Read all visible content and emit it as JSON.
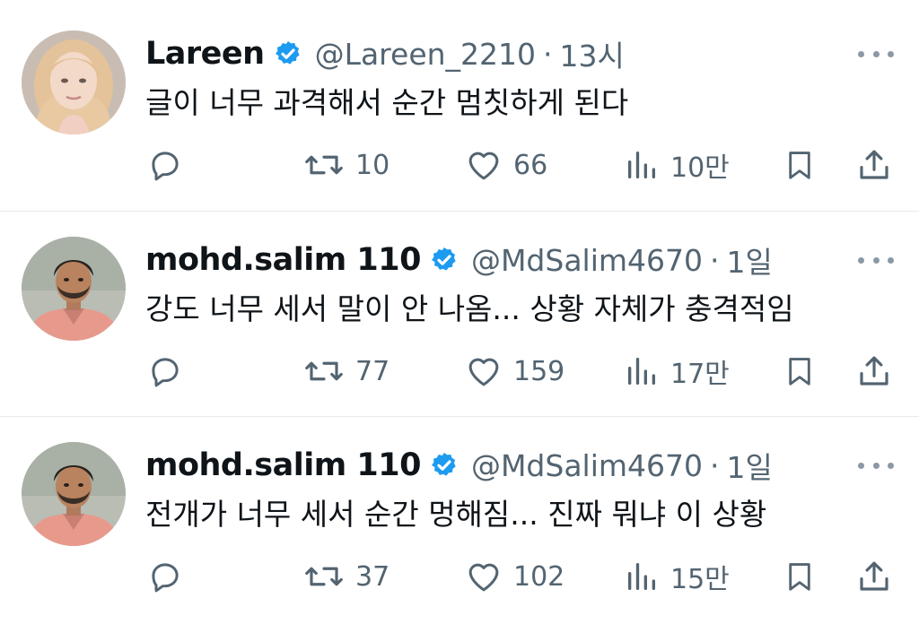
{
  "colors": {
    "verified": "#1d9bf0",
    "secondary_text": "#536471",
    "divider": "#e6e9ec"
  },
  "tweets": [
    {
      "name": "Lareen",
      "verified": true,
      "handle": "@Lareen_2210",
      "separator": "·",
      "time": "13시",
      "text": "글이 너무 과격해서 순간 멈칫하게 된다",
      "avatar": "avatar-blonde-woman",
      "replies": "",
      "retweets": "10",
      "likes": "66",
      "views": "10만"
    },
    {
      "name": "mohd.salim 110",
      "verified": true,
      "handle": "@MdSalim4670",
      "separator": "·",
      "time": "1일",
      "text": "강도 너무 세서 말이 안 나옴... 상황 자체가 충격적임",
      "avatar": "avatar-man-pink-shirt",
      "replies": "",
      "retweets": "77",
      "likes": "159",
      "views": "17만"
    },
    {
      "name": "mohd.salim 110",
      "verified": true,
      "handle": "@MdSalim4670",
      "separator": "·",
      "time": "1일",
      "text": "전개가 너무 세서 순간 멍해짐... 진짜 뭐냐 이 상황",
      "avatar": "avatar-man-pink-shirt",
      "replies": "",
      "retweets": "37",
      "likes": "102",
      "views": "15만"
    }
  ]
}
